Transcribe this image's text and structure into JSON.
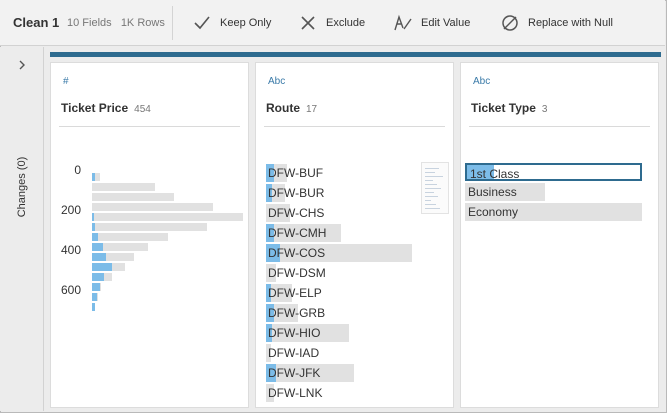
{
  "toolbar": {
    "title": "Clean 1",
    "fields": "10 Fields",
    "rows": "1K Rows",
    "buttons": [
      {
        "label": "Keep Only",
        "icon": "checkmark-icon"
      },
      {
        "label": "Exclude",
        "icon": "x-icon"
      },
      {
        "label": "Edit Value",
        "icon": "pen-icon"
      },
      {
        "label": "Replace with Null",
        "icon": "null-icon"
      }
    ]
  },
  "sidebar": {
    "changes_label": "Changes (0)"
  },
  "cards": {
    "ticket_price": {
      "type_icon": "#",
      "title": "Ticket Price",
      "count": "454",
      "axis": [
        "0",
        "200",
        "400",
        "600"
      ],
      "bins": [
        {
          "total": 0.05,
          "sel": 0.02
        },
        {
          "total": 0.42,
          "sel": 0.0
        },
        {
          "total": 0.54,
          "sel": 0.0
        },
        {
          "total": 0.8,
          "sel": 0.0
        },
        {
          "total": 1.0,
          "sel": 0.01
        },
        {
          "total": 0.76,
          "sel": 0.02
        },
        {
          "total": 0.5,
          "sel": 0.04
        },
        {
          "total": 0.37,
          "sel": 0.07
        },
        {
          "total": 0.28,
          "sel": 0.09
        },
        {
          "total": 0.22,
          "sel": 0.13
        },
        {
          "total": 0.13,
          "sel": 0.08
        },
        {
          "total": 0.06,
          "sel": 0.05
        },
        {
          "total": 0.04,
          "sel": 0.03
        },
        {
          "total": 0.02,
          "sel": 0.02
        }
      ]
    },
    "route": {
      "type_icon": "Abc",
      "title": "Route",
      "count": "17",
      "items": [
        {
          "label": "DFW-BUF",
          "total": 0.13,
          "sel": 0.05
        },
        {
          "label": "DFW-BUR",
          "total": 0.12,
          "sel": 0.04
        },
        {
          "label": "DFW-CHS",
          "total": 0.15,
          "sel": 0.0
        },
        {
          "label": "DFW-CMH",
          "total": 0.47,
          "sel": 0.05
        },
        {
          "label": "DFW-COS",
          "total": 0.91,
          "sel": 0.09
        },
        {
          "label": "DFW-DSM",
          "total": 0.06,
          "sel": 0.0
        },
        {
          "label": "DFW-ELP",
          "total": 0.16,
          "sel": 0.03
        },
        {
          "label": "DFW-GRB",
          "total": 0.2,
          "sel": 0.05
        },
        {
          "label": "DFW-HIO",
          "total": 0.52,
          "sel": 0.04
        },
        {
          "label": "DFW-IAD",
          "total": 0.03,
          "sel": 0.0
        },
        {
          "label": "DFW-JFK",
          "total": 0.55,
          "sel": 0.06
        },
        {
          "label": "DFW-LNK",
          "total": 0.05,
          "sel": 0.0
        }
      ]
    },
    "ticket_type": {
      "type_icon": "Abc",
      "title": "Ticket Type",
      "count": "3",
      "items": [
        {
          "label": "1st Class",
          "total": 1.0,
          "sel": 0.15,
          "selected": true
        },
        {
          "label": "Business",
          "total": 0.45,
          "sel": 0.0,
          "selected": false
        },
        {
          "label": "Economy",
          "total": 1.0,
          "sel": 0.0,
          "selected": false
        }
      ]
    }
  },
  "colors": {
    "accent": "#2e6b8f",
    "bar_gray": "#e1e1e1",
    "bar_blue": "#7cbce8"
  }
}
